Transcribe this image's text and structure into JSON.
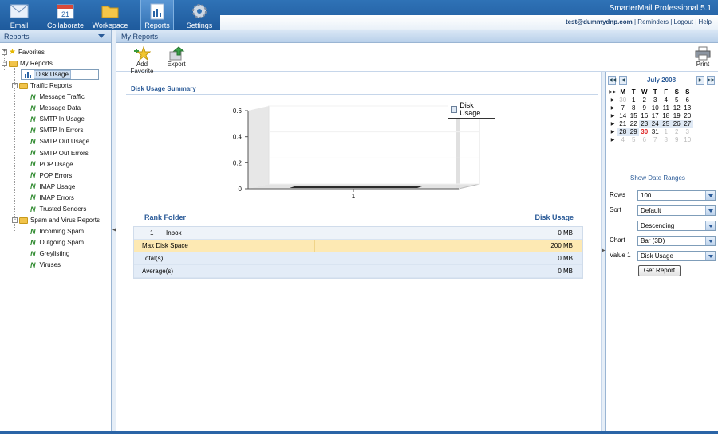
{
  "nav": {
    "items": [
      {
        "label": "Email"
      },
      {
        "label": "Collaborate"
      },
      {
        "label": "Workspace"
      },
      {
        "label": "Reports"
      },
      {
        "label": "Settings"
      }
    ],
    "app_title": "SmarterMail Professional 5.1",
    "user_email": "test@dummydnp.com",
    "links": {
      "reminders": "Reminders",
      "logout": "Logout",
      "help": "Help",
      "sep": "|"
    }
  },
  "left_panel": {
    "title": "Reports",
    "tree": {
      "favorites": "Favorites",
      "my_reports": "My Reports",
      "disk_usage": "Disk Usage",
      "traffic_reports": "Traffic Reports",
      "traffic_items": [
        "Message Traffic",
        "Message Data",
        "SMTP In Usage",
        "SMTP In Errors",
        "SMTP Out Usage",
        "SMTP Out Errors",
        "POP Usage",
        "POP Errors",
        "IMAP Usage",
        "IMAP Errors",
        "Trusted Senders"
      ],
      "spam_reports": "Spam and Virus Reports",
      "spam_items": [
        "Incoming Spam",
        "Outgoing Spam",
        "Greylisting",
        "Viruses"
      ]
    }
  },
  "main": {
    "title": "My Reports",
    "toolbar": {
      "add_favorite": "Add Favorite",
      "export": "Export",
      "print": "Print"
    },
    "section_title": "Disk Usage Summary",
    "table": {
      "col_rank_folder": "Rank Folder",
      "col_disk_usage": "Disk Usage",
      "rows": [
        {
          "rank": "1",
          "folder": "Inbox",
          "value": "0 MB"
        }
      ],
      "max_label": "Max Disk Space",
      "max_value": "200 MB",
      "total_label": "Total(s)",
      "total_value": "0 MB",
      "avg_label": "Average(s)",
      "avg_value": "0 MB"
    }
  },
  "chart_data": {
    "type": "bar",
    "categories": [
      "1"
    ],
    "series": [
      {
        "name": "Disk Usage",
        "values": [
          0
        ]
      }
    ],
    "yticks": [
      "0",
      "0.2",
      "0.4",
      "0.6"
    ],
    "ylim": [
      0,
      0.6
    ],
    "legend": "top-right",
    "style": "3d"
  },
  "calendar": {
    "month": "July 2008",
    "headers": [
      "M",
      "T",
      "W",
      "T",
      "F",
      "S",
      "S"
    ],
    "weeks": [
      [
        "30",
        "1",
        "2",
        "3",
        "4",
        "5",
        "6"
      ],
      [
        "7",
        "8",
        "9",
        "10",
        "11",
        "12",
        "13"
      ],
      [
        "14",
        "15",
        "16",
        "17",
        "18",
        "19",
        "20"
      ],
      [
        "21",
        "22",
        "23",
        "24",
        "25",
        "26",
        "27"
      ],
      [
        "28",
        "29",
        "30",
        "31",
        "1",
        "2",
        "3"
      ],
      [
        "4",
        "5",
        "6",
        "7",
        "8",
        "9",
        "10"
      ]
    ],
    "show_date_ranges": "Show Date Ranges"
  },
  "form": {
    "rows_label": "Rows",
    "rows_value": "100",
    "sort_label": "Sort",
    "sort_value": "Default",
    "order_value": "Descending",
    "chart_label": "Chart",
    "chart_value": "Bar (3D)",
    "value1_label": "Value 1",
    "value1_value": "Disk Usage",
    "get_report": "Get Report"
  }
}
